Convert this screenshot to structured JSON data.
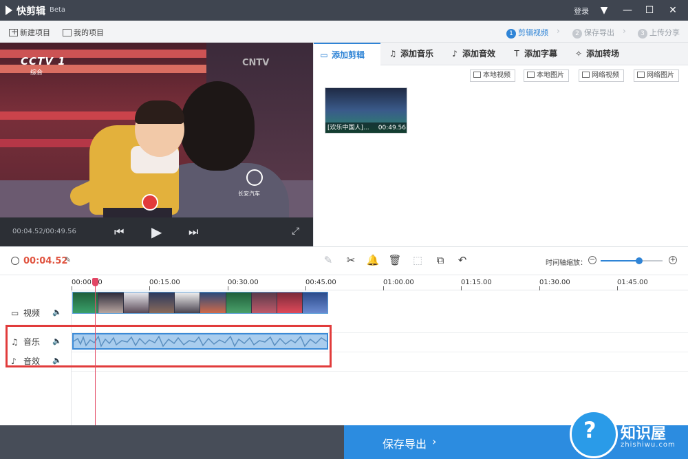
{
  "app": {
    "title": "快剪辑",
    "beta": "Beta",
    "login": "登录",
    "window_controls": [
      "menu-icon",
      "minimize-icon",
      "maximize-icon",
      "close-icon"
    ]
  },
  "toolbar": {
    "new_project": "新建项目",
    "my_projects": "我的项目",
    "steps": [
      {
        "num": "1",
        "label": "剪辑视频",
        "active": true
      },
      {
        "num": "2",
        "label": "保存导出",
        "active": false
      },
      {
        "num": "3",
        "label": "上传分享",
        "active": false
      }
    ]
  },
  "preview": {
    "channel_logo": "CCTV 1",
    "channel_sub": "综合",
    "watermark": "CNTV",
    "badge_text": "长安汽车",
    "timecode": "00:04.52/00:49.56"
  },
  "tabs": [
    {
      "label": "添加剪辑",
      "icon": "video-camera-icon",
      "active": true
    },
    {
      "label": "添加音乐",
      "icon": "music-note-icon",
      "active": false
    },
    {
      "label": "添加音效",
      "icon": "sound-effect-icon",
      "active": false
    },
    {
      "label": "添加字幕",
      "icon": "text-icon",
      "active": false
    },
    {
      "label": "添加转场",
      "icon": "transition-icon",
      "active": false
    }
  ],
  "sources": [
    "本地视频",
    "本地图片",
    "网络视频",
    "网络图片"
  ],
  "media": {
    "title": "[欢乐中国人]...",
    "duration": "00:49.56"
  },
  "timeline": {
    "current_time": "00:04.52",
    "zoom_label": "时间轴缩放：",
    "zoom_level": 0.62,
    "ruler": [
      "00:00.00",
      "00:15.00",
      "00:30.00",
      "00:45.00",
      "01:00.00",
      "01:15.00",
      "01:30.00",
      "01:45.00"
    ],
    "tracks": [
      {
        "name": "视频",
        "icon": "video-camera-icon"
      },
      {
        "name": "音乐",
        "icon": "music-note-icon"
      },
      {
        "name": "音效",
        "icon": "sound-effect-icon"
      }
    ]
  },
  "bottom": {
    "save_export": "保存导出"
  },
  "watermark": {
    "title": "知识屋",
    "sub": "zhishiwu.com"
  },
  "colors": {
    "accent": "#2f84d6",
    "time_red": "#e0533f",
    "highlight": "#e13b3b"
  }
}
